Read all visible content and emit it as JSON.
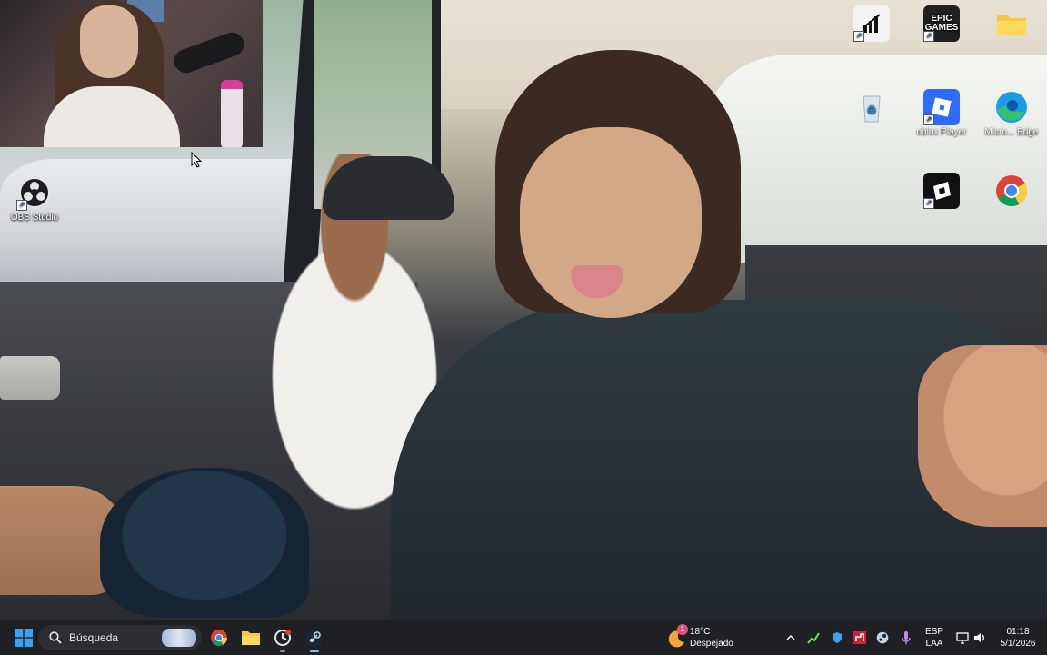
{
  "desktop": {
    "icons": [
      {
        "label": "OBS Studio",
        "icon": "obs-icon"
      },
      {
        "label": "",
        "icon": "app-shortcut-icon"
      },
      {
        "label": "",
        "icon": "epic-games-icon",
        "glyph_text": "EPIC\nGAMES"
      },
      {
        "label": "",
        "icon": "folder-icon"
      },
      {
        "label": "",
        "icon": "recycle-bin-icon"
      },
      {
        "label": "oblox Player",
        "icon": "roblox-player-icon"
      },
      {
        "label": "Micro... Edge",
        "icon": "edge-icon"
      },
      {
        "label": "",
        "icon": "roblox-studio-icon"
      },
      {
        "label": "",
        "icon": "chrome-icon"
      }
    ]
  },
  "webcam": {
    "visible": true
  },
  "taskbar": {
    "search_placeholder": "Búsqueda",
    "pinned": [
      "start-icon",
      "search-icon",
      "chrome-icon",
      "file-explorer-icon",
      "app-icon",
      "steam-icon"
    ],
    "weather": {
      "temperature": "18°C",
      "condition": "Despejado",
      "badge": "1"
    },
    "tray": {
      "language_top": "ESP",
      "language_bottom": "LAA",
      "time": "01:18",
      "date": "5/1/2026"
    }
  },
  "colors": {
    "taskbar_bg": "#1f2024",
    "start_blue": "#3aa0f2",
    "roblox_blue": "#2f6bff"
  }
}
